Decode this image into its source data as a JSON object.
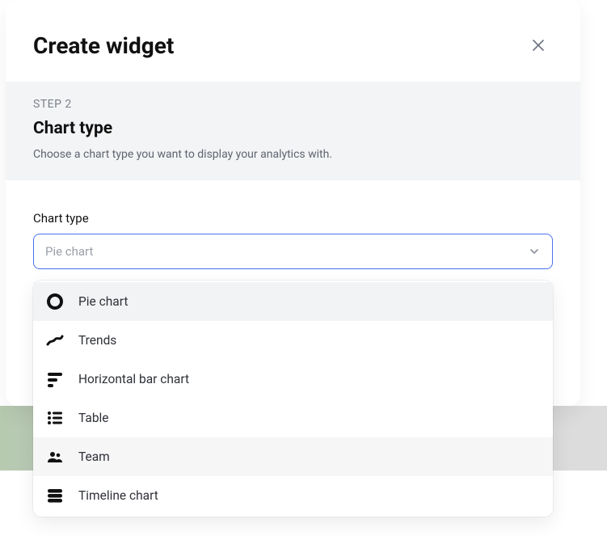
{
  "modal": {
    "title": "Create widget"
  },
  "step": {
    "label": "STEP 2",
    "title": "Chart type",
    "description": "Choose a chart type you want to display your analytics with."
  },
  "field": {
    "label": "Chart type",
    "placeholder": "Pie chart"
  },
  "options": [
    {
      "label": "Pie chart",
      "icon": "pie",
      "highlight": true,
      "hovered": false
    },
    {
      "label": "Trends",
      "icon": "trends",
      "highlight": false,
      "hovered": false
    },
    {
      "label": "Horizontal bar chart",
      "icon": "hbars",
      "highlight": false,
      "hovered": false
    },
    {
      "label": "Table",
      "icon": "table",
      "highlight": false,
      "hovered": false
    },
    {
      "label": "Team",
      "icon": "team",
      "highlight": false,
      "hovered": true
    },
    {
      "label": "Timeline chart",
      "icon": "timeline",
      "highlight": false,
      "hovered": false
    }
  ]
}
